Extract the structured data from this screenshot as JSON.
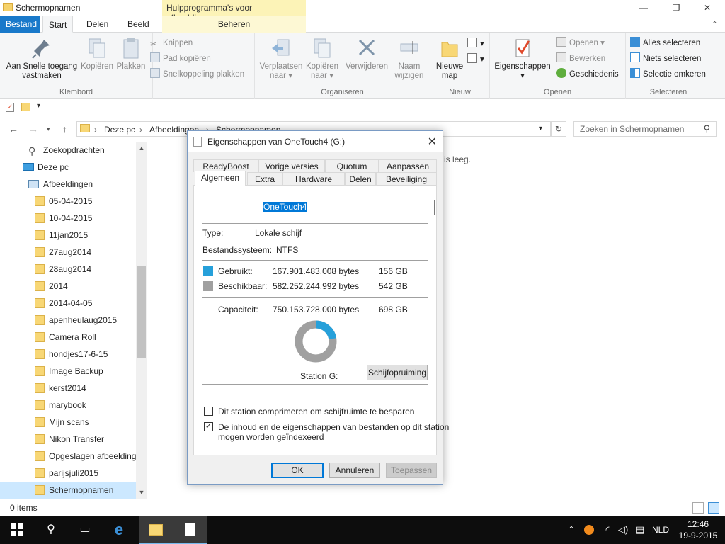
{
  "window": {
    "title": "Schermopnamen",
    "contextual_tab": "Hulpprogramma's voor afbeeldingen",
    "minimize": "—",
    "maximize": "❐",
    "close": "✕"
  },
  "ribbon_tabs": {
    "file": "Bestand",
    "start": "Start",
    "share": "Delen",
    "view": "Beeld",
    "manage": "Beheren"
  },
  "ribbon": {
    "klembord": {
      "label": "Klembord",
      "pin": "Aan Snelle toegang vastmaken",
      "copy": "Kopiëren",
      "paste": "Plakken",
      "cut": "Knippen",
      "copy_path": "Pad kopiëren",
      "paste_shortcut": "Snelkoppeling plakken"
    },
    "organiseren": {
      "label": "Organiseren",
      "move_to": "Verplaatsen naar",
      "copy_to": "Kopiëren naar",
      "delete": "Verwijderen",
      "rename": "Naam wijzigen"
    },
    "nieuw": {
      "label": "Nieuw",
      "new_folder": "Nieuwe map"
    },
    "openen": {
      "label": "Openen",
      "properties": "Eigenschappen",
      "open": "Openen",
      "edit": "Bewerken",
      "history": "Geschiedenis"
    },
    "selecteren": {
      "label": "Selecteren",
      "select_all": "Alles selecteren",
      "select_none": "Niets selecteren",
      "invert": "Selectie omkeren"
    }
  },
  "address": {
    "crumbs": [
      "Deze pc",
      "Afbeeldingen",
      "Schermopnamen"
    ],
    "search_placeholder": "Zoeken in Schermopnamen"
  },
  "nav": {
    "search": "Zoekopdrachten",
    "this_pc": "Deze pc",
    "pictures": "Afbeeldingen",
    "folders": [
      "05-04-2015",
      "10-04-2015",
      "11jan2015",
      "27aug2014",
      "28aug2014",
      "2014",
      "2014-04-05",
      "apenheulaug2015",
      "Camera Roll",
      "hondjes17-6-15",
      "Image Backup",
      "kerst2014",
      "marybook",
      "Mijn scans",
      "Nikon Transfer",
      "Opgeslagen afbeelding",
      "parijsjuli2015",
      "Schermopnamen"
    ]
  },
  "main": {
    "empty_text": "is leeg."
  },
  "status": {
    "count": "0 items"
  },
  "dialog": {
    "title": "Eigenschappen van OneTouch4 (G:)",
    "tabs_top": [
      "ReadyBoost",
      "Vorige versies",
      "Quotum",
      "Aanpassen"
    ],
    "tabs_bottom": [
      "Algemeen",
      "Extra",
      "Hardware",
      "Delen",
      "Beveiliging"
    ],
    "name": "OneTouch4",
    "type_label": "Type:",
    "type_value": "Lokale schijf",
    "fs_label": "Bestandssysteem:",
    "fs_value": "NTFS",
    "used_label": "Gebruikt:",
    "used_bytes": "167.901.483.008 bytes",
    "used_gb": "156 GB",
    "free_label": "Beschikbaar:",
    "free_bytes": "582.252.244.992 bytes",
    "free_gb": "542 GB",
    "cap_label": "Capaciteit:",
    "cap_bytes": "750.153.728.000 bytes",
    "cap_gb": "698 GB",
    "used_fraction": 0.224,
    "station": "Station G:",
    "cleanup": "Schijfopruiming",
    "compress": "Dit station comprimeren om schijfruimte te besparen",
    "index_line1": "De inhoud en de eigenschappen van bestanden op dit station",
    "index_line2": "mogen worden geïndexeerd",
    "ok": "OK",
    "cancel": "Annuleren",
    "apply": "Toepassen",
    "colors": {
      "used": "#26a0da",
      "free": "#a0a0a0"
    }
  },
  "tray": {
    "lang": "NLD",
    "time": "12:46",
    "date": "19-9-2015"
  }
}
